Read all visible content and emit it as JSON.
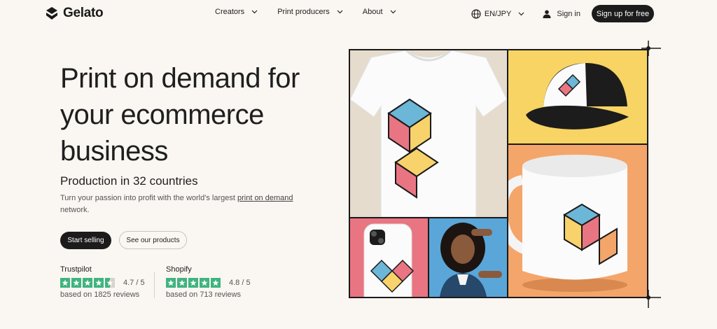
{
  "brand": {
    "name": "Gelato"
  },
  "nav": {
    "items": [
      {
        "label": "Creators"
      },
      {
        "label": "Print producers"
      },
      {
        "label": "About"
      }
    ],
    "language": "EN/JPY",
    "signin": "Sign in",
    "signup": "Sign up for free"
  },
  "hero": {
    "title": "Print on demand for your ecommerce business",
    "subtitle": "Production in 32 countries",
    "desc_before": "Turn your passion into profit with the world's largest ",
    "desc_link": "print on demand",
    "desc_after": " network.",
    "primary_button": "Start selling",
    "secondary_button": "See our products"
  },
  "ratings": [
    {
      "source": "Trustpilot",
      "score": "4.7 / 5",
      "reviews": "based on 1825 reviews",
      "stars": 4.5
    },
    {
      "source": "Shopify",
      "score": "4.8 / 5",
      "reviews": "based on 713 reviews",
      "stars": 5
    }
  ],
  "colors": {
    "background": "#faf6f1",
    "button_dark": "#1c1c1c",
    "star_green": "#3fb37f",
    "tile_yellow": "#f7d463",
    "tile_orange": "#f4a56a",
    "tile_pink": "#e97583",
    "tile_blue": "#5aa6d8"
  },
  "icons": {
    "logo": "gelato-logo-icon",
    "globe": "globe-icon",
    "user": "user-icon",
    "chevron": "chevron-down-icon",
    "star": "star-icon"
  }
}
